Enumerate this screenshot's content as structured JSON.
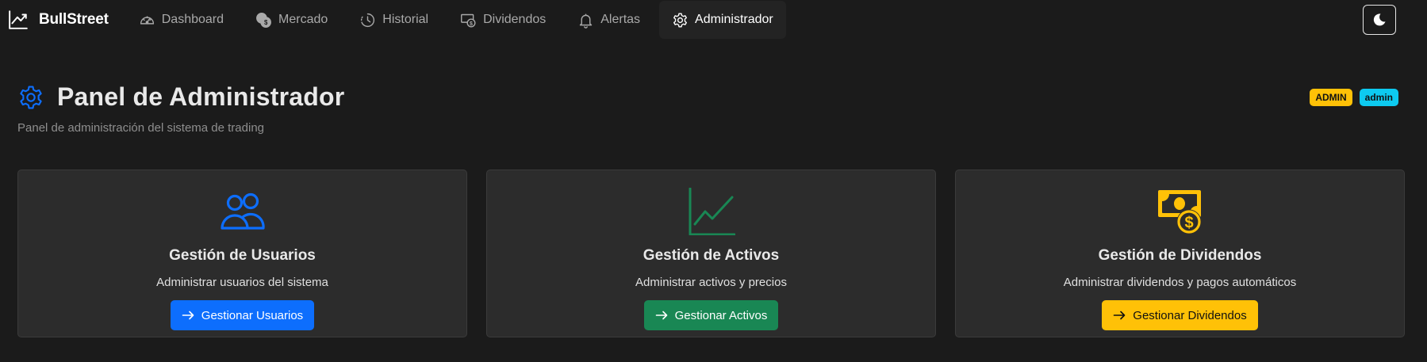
{
  "app": {
    "brand": "BullStreet"
  },
  "nav": {
    "items": [
      {
        "label": "Dashboard",
        "icon": "speedometer-icon"
      },
      {
        "label": "Mercado",
        "icon": "coins-icon"
      },
      {
        "label": "Historial",
        "icon": "clock-history-icon"
      },
      {
        "label": "Dividendos",
        "icon": "cash-coin-icon"
      },
      {
        "label": "Alertas",
        "icon": "bell-icon"
      },
      {
        "label": "Administrador",
        "icon": "gear-icon",
        "active": true
      }
    ],
    "theme_toggle_icon": "moon-icon"
  },
  "header": {
    "title": "Panel de Administrador",
    "subtitle": "Panel de administración del sistema de trading",
    "badges": [
      {
        "label": "ADMIN",
        "color": "#ffc107"
      },
      {
        "label": "admin",
        "color": "#0dcaf0"
      }
    ]
  },
  "cards": [
    {
      "icon": "people-icon",
      "title": "Gestión de Usuarios",
      "description": "Administrar usuarios del sistema",
      "button": "Gestionar Usuarios",
      "color": "#0d6efd"
    },
    {
      "icon": "graph-up-icon",
      "title": "Gestión de Activos",
      "description": "Administrar activos y precios",
      "button": "Gestionar Activos",
      "color": "#198754"
    },
    {
      "icon": "cash-coin-icon",
      "title": "Gestión de Dividendos",
      "description": "Administrar dividendos y pagos automáticos",
      "button": "Gestionar Dividendos",
      "color": "#ffc107"
    }
  ],
  "colors": {
    "background": "#1b1b1b",
    "card": "#2c2c2c",
    "accent_blue": "#0d6efd",
    "accent_green": "#198754",
    "accent_yellow": "#ffc107",
    "accent_cyan": "#0dcaf0"
  }
}
